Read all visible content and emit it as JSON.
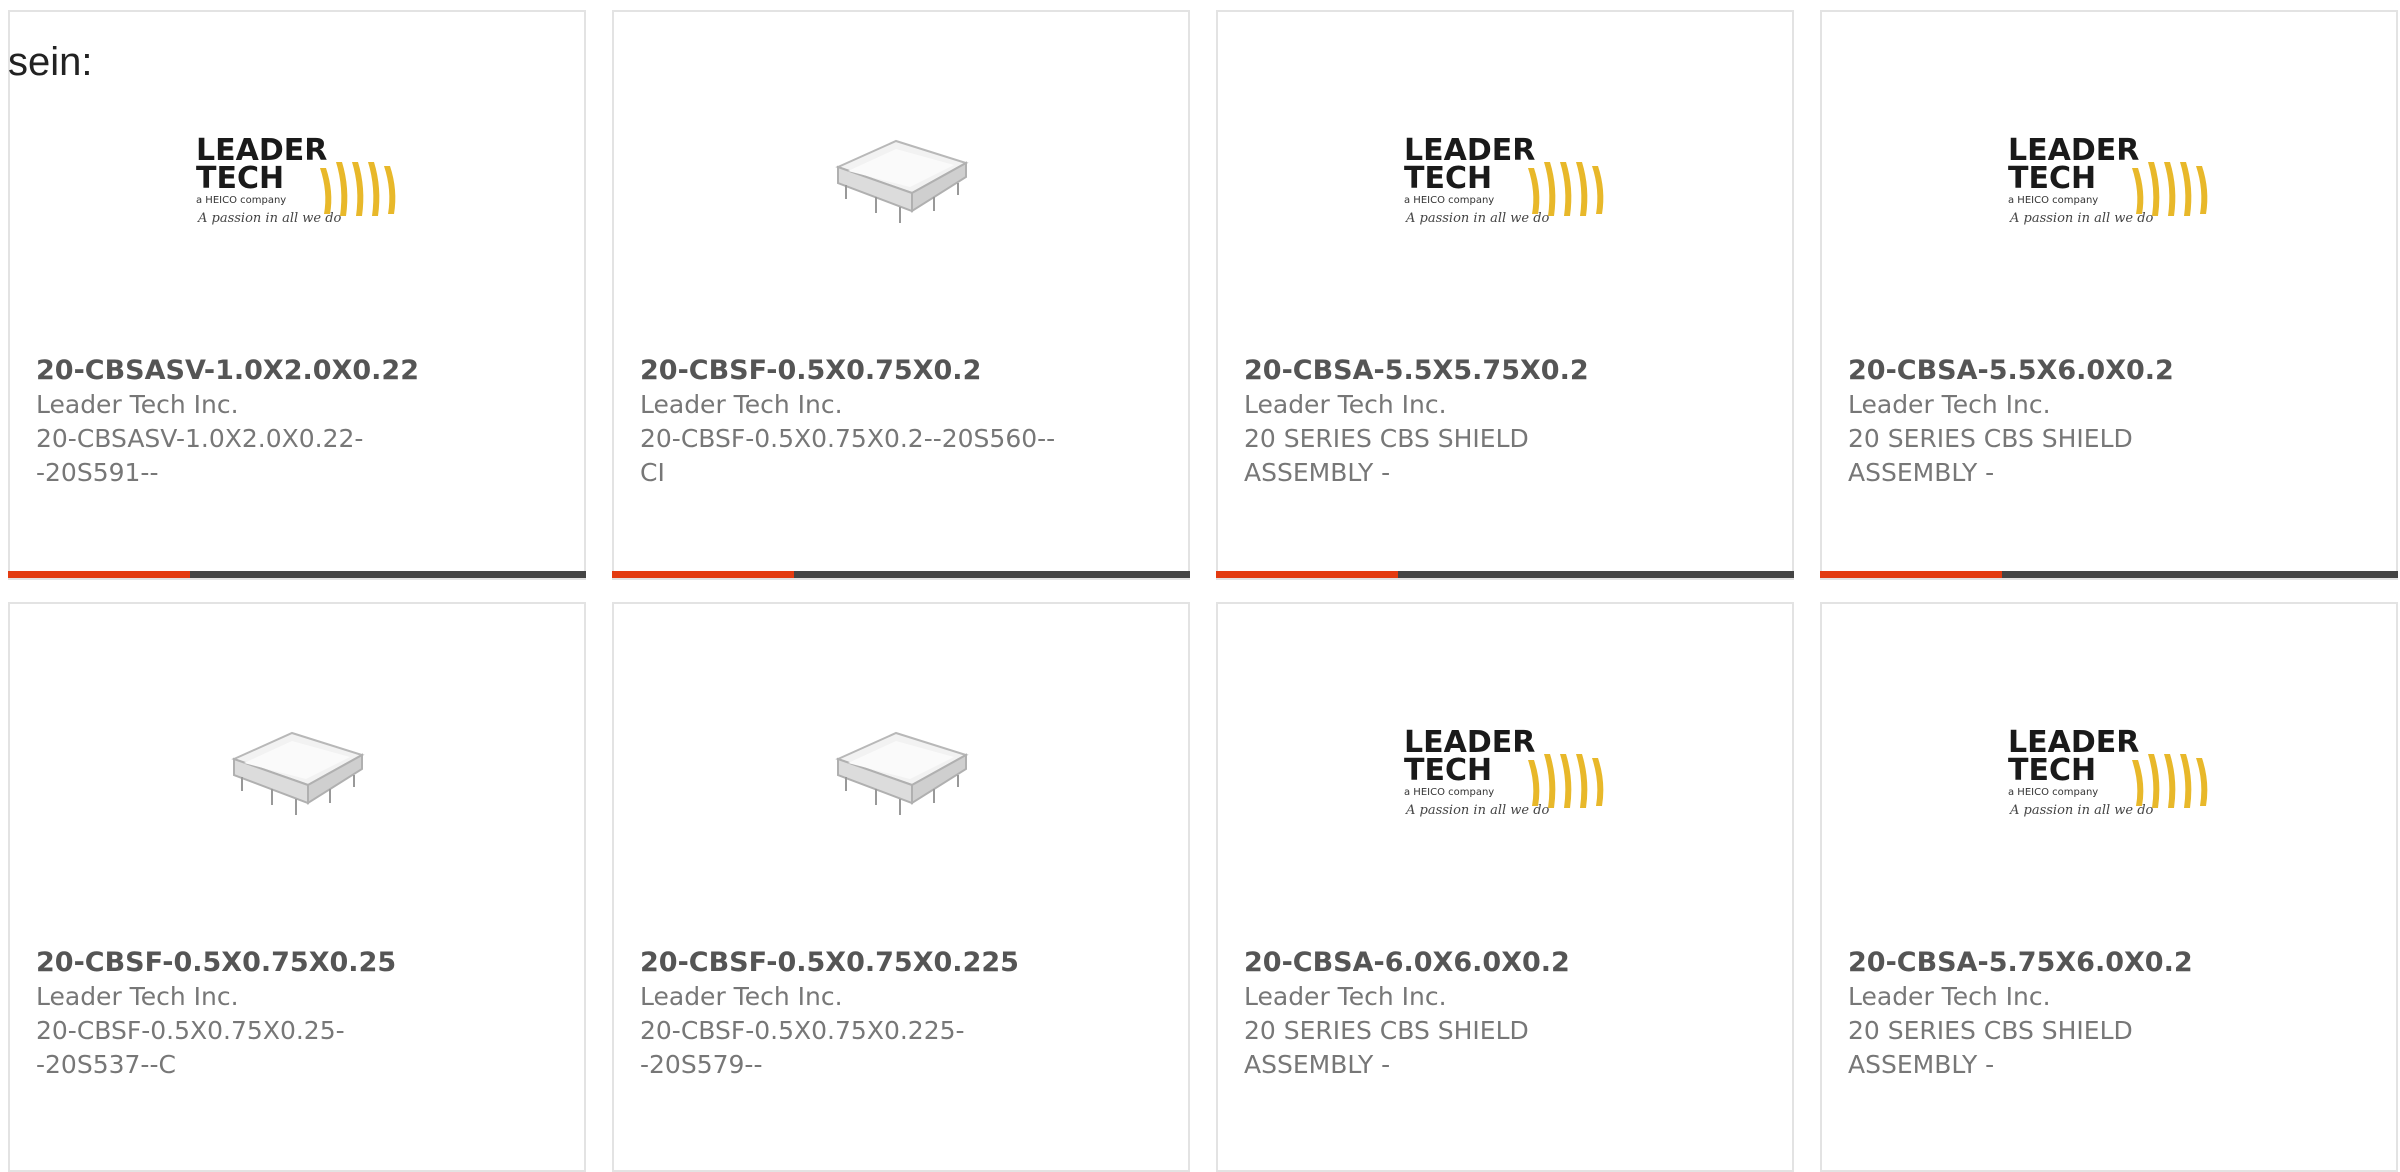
{
  "intro_text": "sein:",
  "colors": {
    "accent_bar": "#e33b11",
    "bar_track": "#444444",
    "logo_yellow": "#e8b82a"
  },
  "products": [
    {
      "part_number": "20-CBSASV-1.0X2.0X0.22",
      "manufacturer": "Leader Tech Inc.",
      "description": "20-CBSASV-1.0X2.0X0.22--20S591--",
      "image": "leader-tech-logo",
      "logo": {
        "line1": "LEADER",
        "line2": "TECH",
        "company": "a HEICO company",
        "tagline": "A passion in all we do"
      }
    },
    {
      "part_number": "20-CBSF-0.5X0.75X0.2",
      "manufacturer": "Leader Tech Inc.",
      "description": "20-CBSF-0.5X0.75X0.2--20S560--CI",
      "image": "shield-can-photo"
    },
    {
      "part_number": "20-CBSA-5.5X5.75X0.2",
      "manufacturer": "Leader Tech Inc.",
      "description": "20 SERIES CBS SHIELD ASSEMBLY -",
      "image": "leader-tech-logo",
      "logo": {
        "line1": "LEADER",
        "line2": "TECH",
        "company": "a HEICO company",
        "tagline": "A passion in all we do"
      }
    },
    {
      "part_number": "20-CBSA-5.5X6.0X0.2",
      "manufacturer": "Leader Tech Inc.",
      "description": "20 SERIES CBS SHIELD ASSEMBLY -",
      "image": "leader-tech-logo",
      "logo": {
        "line1": "LEADER",
        "line2": "TECH",
        "company": "a HEICO company",
        "tagline": "A passion in all we do"
      }
    },
    {
      "part_number": "20-CBSF-0.5X0.75X0.25",
      "manufacturer": "Leader Tech Inc.",
      "description": "20-CBSF-0.5X0.75X0.25--20S537--C",
      "image": "shield-can-photo"
    },
    {
      "part_number": "20-CBSF-0.5X0.75X0.225",
      "manufacturer": "Leader Tech Inc.",
      "description": "20-CBSF-0.5X0.75X0.225--20S579--",
      "image": "shield-can-photo"
    },
    {
      "part_number": "20-CBSA-6.0X6.0X0.2",
      "manufacturer": "Leader Tech Inc.",
      "description": "20 SERIES CBS SHIELD ASSEMBLY -",
      "image": "leader-tech-logo",
      "logo": {
        "line1": "LEADER",
        "line2": "TECH",
        "company": "a HEICO company",
        "tagline": "A passion in all we do"
      }
    },
    {
      "part_number": "20-CBSA-5.75X6.0X0.2",
      "manufacturer": "Leader Tech Inc.",
      "description": "20 SERIES CBS SHIELD ASSEMBLY -",
      "image": "leader-tech-logo",
      "logo": {
        "line1": "LEADER",
        "line2": "TECH",
        "company": "a HEICO company",
        "tagline": "A passion in all we do"
      }
    }
  ]
}
